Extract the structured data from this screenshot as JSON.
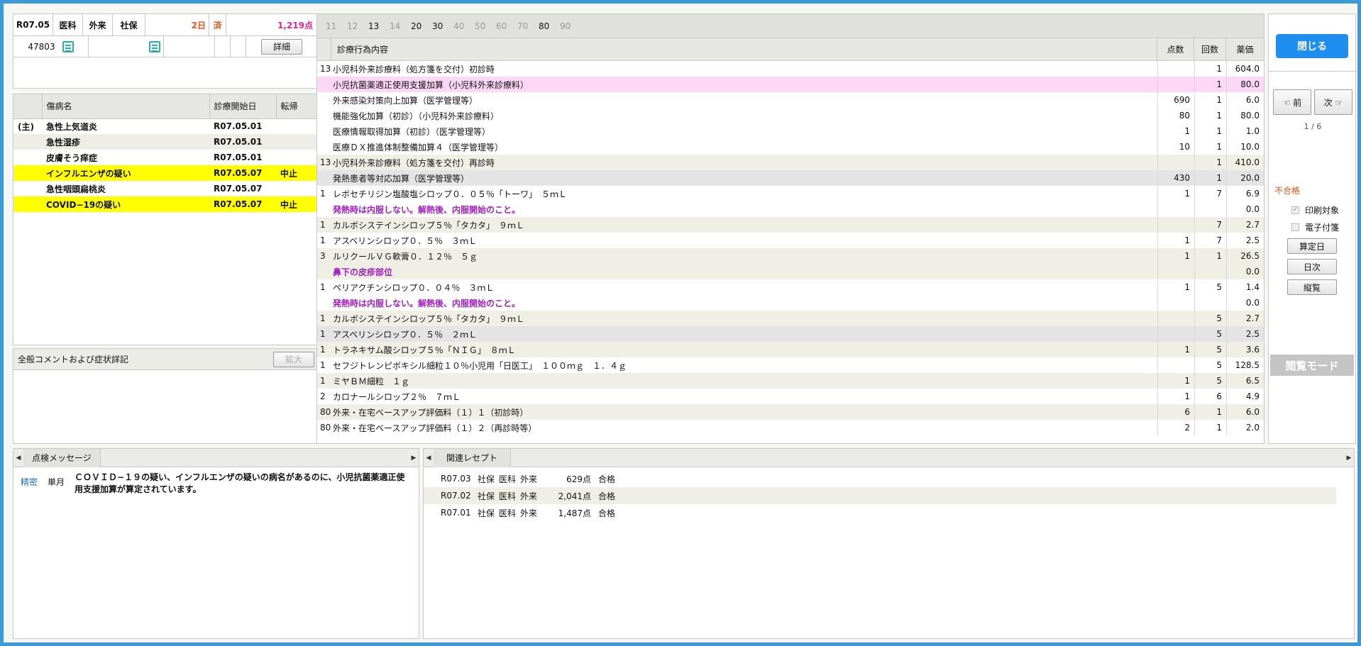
{
  "header": {
    "era_month": "R07.05",
    "dept": "医科",
    "visit_type": "外来",
    "insurance": "社保",
    "days": "2日",
    "status": "済",
    "points": "1,219点",
    "patient_id": "47803",
    "detail_label": "詳細"
  },
  "diseases": {
    "headers": [
      "傷病名",
      "診療開始日",
      "転帰"
    ],
    "rows": [
      {
        "prefix": "(主)",
        "name": "急性上気道炎",
        "date": "R07.05.01",
        "outcome": "",
        "style": ""
      },
      {
        "prefix": "",
        "name": "急性湿疹",
        "date": "R07.05.01",
        "outcome": "",
        "style": "alt"
      },
      {
        "prefix": "",
        "name": "皮膚そう痒症",
        "date": "R07.05.01",
        "outcome": "",
        "style": ""
      },
      {
        "prefix": "",
        "name": "インフルエンザの疑い",
        "date": "R07.05.07",
        "outcome": "中止",
        "style": "hl"
      },
      {
        "prefix": "",
        "name": "急性咽頭扁桃炎",
        "date": "R07.05.07",
        "outcome": "",
        "style": ""
      },
      {
        "prefix": "",
        "name": "COVID−19の疑い",
        "date": "R07.05.07",
        "outcome": "中止",
        "style": "hl"
      }
    ]
  },
  "comment": {
    "title": "全般コメントおよび症状詳記",
    "expand_label": "拡大"
  },
  "treatments": {
    "day_tabs": [
      {
        "label": "11",
        "on": false
      },
      {
        "label": "12",
        "on": false
      },
      {
        "label": "13",
        "on": true
      },
      {
        "label": "14",
        "on": false
      },
      {
        "label": "20",
        "on": true
      },
      {
        "label": "30",
        "on": true
      },
      {
        "label": "40",
        "on": false
      },
      {
        "label": "50",
        "on": false
      },
      {
        "label": "60",
        "on": false
      },
      {
        "label": "70",
        "on": false
      },
      {
        "label": "80",
        "on": true
      },
      {
        "label": "90",
        "on": false
      }
    ],
    "headers": {
      "content": "診療行為内容",
      "points": "点数",
      "count": "回数",
      "price": "薬価"
    },
    "rows": [
      {
        "code": "13",
        "name": "小児科外来診療料（処方箋を交付）初診時",
        "pts": "",
        "cnt": "1",
        "price": "604.0",
        "style": "",
        "note": false
      },
      {
        "code": "",
        "name": "小児抗菌薬適正使用支援加算（小児科外来診療料）",
        "pts": "",
        "cnt": "1",
        "price": "80.0",
        "style": "pink",
        "note": false
      },
      {
        "code": "",
        "name": "外来感染対策向上加算（医学管理等）",
        "pts": "690",
        "cnt": "1",
        "price": "6.0",
        "style": "",
        "note": false
      },
      {
        "code": "",
        "name": "機能強化加算（初診）（小児科外来診療料）",
        "pts": "80",
        "cnt": "1",
        "price": "80.0",
        "style": "",
        "note": false
      },
      {
        "code": "",
        "name": "医療情報取得加算（初診）（医学管理等）",
        "pts": "1",
        "cnt": "1",
        "price": "1.0",
        "style": "",
        "note": false
      },
      {
        "code": "",
        "name": "医療ＤＸ推進体制整備加算４（医学管理等）",
        "pts": "10",
        "cnt": "1",
        "price": "10.0",
        "style": "",
        "note": false
      },
      {
        "code": "13",
        "name": "小児科外来診療料（処方箋を交付）再診時",
        "pts": "",
        "cnt": "1",
        "price": "410.0",
        "style": "alt",
        "note": false
      },
      {
        "code": "",
        "name": "発熱患者等対応加算（医学管理等）",
        "pts": "430",
        "cnt": "1",
        "price": "20.0",
        "style": "grey",
        "note": false
      },
      {
        "code": "1",
        "name": "レボセチリジン塩酸塩シロップ０．０５％「トーワ」　５ｍＬ",
        "pts": "1",
        "cnt": "7",
        "price": "6.9",
        "style": "",
        "note": false
      },
      {
        "code": "",
        "name": "発熱時は内服しない。解熱後、内服開始のこと。",
        "pts": "",
        "cnt": "",
        "price": "0.0",
        "style": "",
        "note": true
      },
      {
        "code": "1",
        "name": "カルボシステインシロップ５％「タカタ」　９ｍＬ",
        "pts": "",
        "cnt": "7",
        "price": "2.7",
        "style": "alt",
        "note": false
      },
      {
        "code": "1",
        "name": "アスベリンシロップ０．５％　３ｍＬ",
        "pts": "1",
        "cnt": "7",
        "price": "2.5",
        "style": "",
        "note": false
      },
      {
        "code": "3",
        "name": "ルリクールＶＧ軟膏０．１２％　５ｇ",
        "pts": "1",
        "cnt": "1",
        "price": "26.5",
        "style": "alt",
        "note": false
      },
      {
        "code": "",
        "name": "鼻下の皮疹部位",
        "pts": "",
        "cnt": "",
        "price": "0.0",
        "style": "alt",
        "note": true
      },
      {
        "code": "1",
        "name": "ペリアクチンシロップ０．０４％　３ｍＬ",
        "pts": "1",
        "cnt": "5",
        "price": "1.4",
        "style": "",
        "note": false
      },
      {
        "code": "",
        "name": "発熱時は内服しない。解熱後、内服開始のこと。",
        "pts": "",
        "cnt": "",
        "price": "0.0",
        "style": "",
        "note": true
      },
      {
        "code": "1",
        "name": "カルボシステインシロップ５％「タカタ」　９ｍＬ",
        "pts": "",
        "cnt": "5",
        "price": "2.7",
        "style": "alt",
        "note": false
      },
      {
        "code": "1",
        "name": "アスベリンシロップ０．５％　２ｍＬ",
        "pts": "",
        "cnt": "5",
        "price": "2.5",
        "style": "grey",
        "note": false
      },
      {
        "code": "1",
        "name": "トラネキサム酸シロップ５％「ＮＩＧ」　８ｍＬ",
        "pts": "1",
        "cnt": "5",
        "price": "3.6",
        "style": "alt",
        "note": false
      },
      {
        "code": "1",
        "name": "セフジトレンピボキシル細粒１０％小児用「日医工」　１００ｍｇ　１．４ｇ",
        "pts": "",
        "cnt": "5",
        "price": "128.5",
        "style": "",
        "note": false
      },
      {
        "code": "1",
        "name": "ミヤＢＭ細粒　１ｇ",
        "pts": "1",
        "cnt": "5",
        "price": "6.5",
        "style": "alt",
        "note": false
      },
      {
        "code": "2",
        "name": "カロナールシロップ２％　７ｍＬ",
        "pts": "1",
        "cnt": "6",
        "price": "4.9",
        "style": "",
        "note": false
      },
      {
        "code": "80",
        "name": "外来・在宅ベースアップ評価料（１）１（初診時）",
        "pts": "6",
        "cnt": "1",
        "price": "6.0",
        "style": "alt",
        "note": false
      },
      {
        "code": "80",
        "name": "外来・在宅ベースアップ評価料（１）２（再診時等）",
        "pts": "2",
        "cnt": "1",
        "price": "2.0",
        "style": "",
        "note": false
      }
    ]
  },
  "controls": {
    "close_label": "閉じる",
    "prev_label": "前",
    "next_label": "次",
    "page_indicator": "1 / 6",
    "verdict": "不合格",
    "print_target": "印刷対象",
    "electronic_attach": "電子付箋",
    "calc_date_label": "算定日",
    "daily_label": "日次",
    "vertical_label": "縦覧",
    "view_mode": "閲覧モード"
  },
  "check_messages": {
    "tab_label": "点検メッセージ",
    "items": [
      {
        "level": "精密",
        "period": "単月",
        "text": "ＣＯＶＩＤ−１９の疑い、インフルエンザの疑いの病名があるのに、小児抗菌薬適正使用支援加算が算定されています。"
      }
    ]
  },
  "related": {
    "tab_label": "関連レセプト",
    "rows": [
      {
        "month": "R07.03",
        "ins": "社保",
        "dept": "医科",
        "type": "外来",
        "points": "629点",
        "result": "合格"
      },
      {
        "month": "R07.02",
        "ins": "社保",
        "dept": "医科",
        "type": "外来",
        "points": "2,041点",
        "result": "合格"
      },
      {
        "month": "R07.01",
        "ins": "社保",
        "dept": "医科",
        "type": "外来",
        "points": "1,487点",
        "result": "合格"
      }
    ]
  },
  "colors": {
    "frame": "#3d9ad6",
    "highlight": "#ffff00",
    "pink_row": "#fcd8f6",
    "note_text": "#a020c0",
    "close_button": "#1e8ff0",
    "verdict_text": "#e0561b"
  }
}
